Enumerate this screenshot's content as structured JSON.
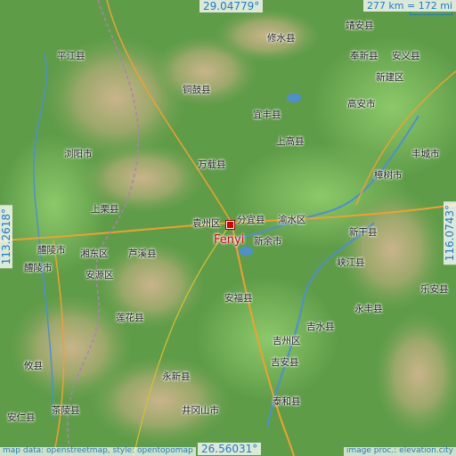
{
  "map": {
    "target_name": "Fenyi",
    "lat_top": "29.04779°",
    "lat_bottom": "26.56031°",
    "lon_left": "113.2618°",
    "lon_right": "116.0743°",
    "scale": "277 km = 172 mi",
    "attribution_left": "map data: openstreetmap, style: opentopomap",
    "attribution_right": "image proc.: elevation.city"
  },
  "places": [
    {
      "id": "xiushui",
      "name": "修水县"
    },
    {
      "id": "jing-an",
      "name": "靖安县"
    },
    {
      "id": "fengxin",
      "name": "奉新县"
    },
    {
      "id": "anyi",
      "name": "安义县"
    },
    {
      "id": "xinjian",
      "name": "新建区"
    },
    {
      "id": "pingjiang",
      "name": "平江县"
    },
    {
      "id": "tonggu",
      "name": "铜鼓县"
    },
    {
      "id": "yifeng",
      "name": "宜丰县"
    },
    {
      "id": "gao-an",
      "name": "高安市"
    },
    {
      "id": "liuyang",
      "name": "浏阳市"
    },
    {
      "id": "shanggao",
      "name": "上高县"
    },
    {
      "id": "fengcheng",
      "name": "丰城市"
    },
    {
      "id": "wanzai",
      "name": "万载县"
    },
    {
      "id": "zhangshu",
      "name": "樟树市"
    },
    {
      "id": "shangli",
      "name": "上栗县"
    },
    {
      "id": "yuanzhou",
      "name": "袁州区"
    },
    {
      "id": "fenyi",
      "name": "分宜县"
    },
    {
      "id": "yushui",
      "name": "渝水区"
    },
    {
      "id": "xinyu",
      "name": "新余市"
    },
    {
      "id": "xingan",
      "name": "新干县"
    },
    {
      "id": "liling",
      "name": "醴陵市"
    },
    {
      "id": "xiangdong",
      "name": "湘东区"
    },
    {
      "id": "luxi",
      "name": "芦溪县"
    },
    {
      "id": "anyuan",
      "name": "安源区"
    },
    {
      "id": "liling2",
      "name": "醴陵市"
    },
    {
      "id": "xiajiang",
      "name": "峡江县"
    },
    {
      "id": "anfu",
      "name": "安福县"
    },
    {
      "id": "yongfeng",
      "name": "永丰县"
    },
    {
      "id": "le-an",
      "name": "乐安县"
    },
    {
      "id": "jishui",
      "name": "吉水县"
    },
    {
      "id": "lianhua",
      "name": "莲花县"
    },
    {
      "id": "jizhou",
      "name": "吉州区"
    },
    {
      "id": "ji-an",
      "name": "吉安县"
    },
    {
      "id": "youxian",
      "name": "攸县"
    },
    {
      "id": "yongxin",
      "name": "永新县"
    },
    {
      "id": "chaling",
      "name": "茶陵县"
    },
    {
      "id": "jinggangshan",
      "name": "井冈山市"
    },
    {
      "id": "taihe",
      "name": "泰和县"
    },
    {
      "id": "anren",
      "name": "安仁县"
    }
  ]
}
